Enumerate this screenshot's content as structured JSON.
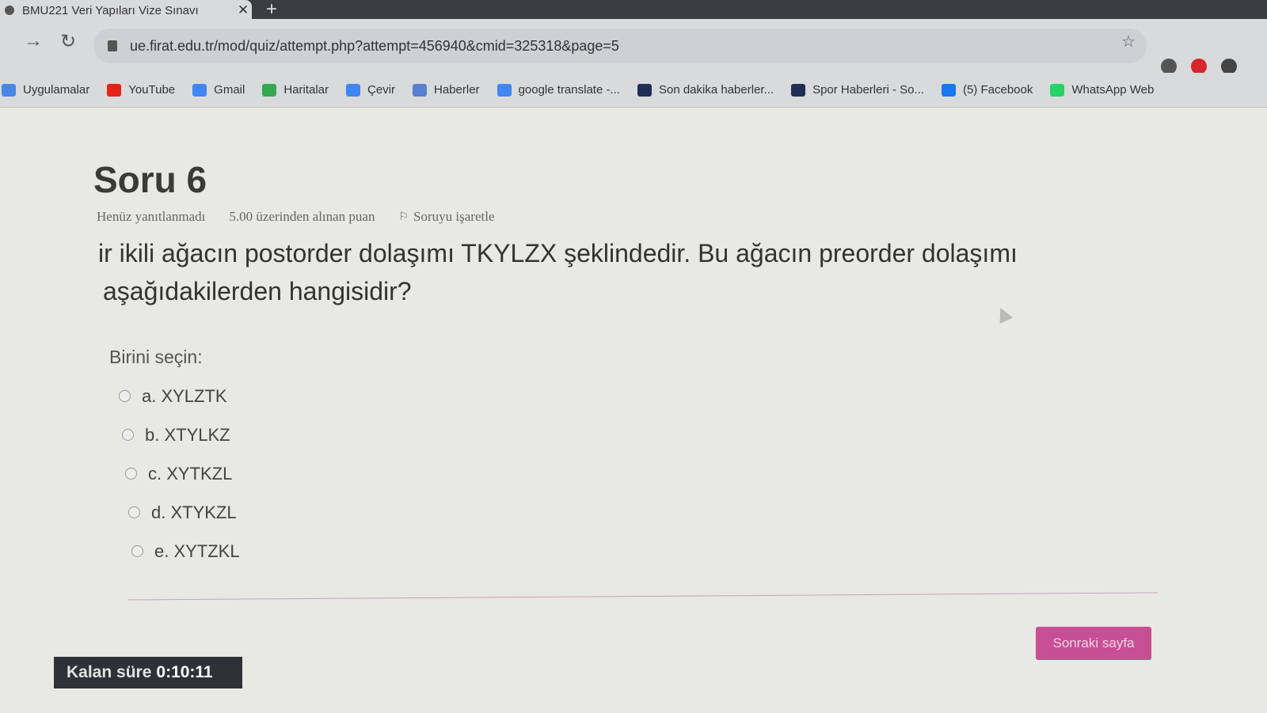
{
  "browser": {
    "tab_title": "BMU221 Veri Yapıları Vize Sınavı",
    "tab_close": "✕",
    "new_tab": "+",
    "url": "ue.firat.edu.tr/mod/quiz/attempt.php?attempt=456940&cmid=325318&page=5",
    "bookmarks": [
      {
        "label": "Uygulamalar",
        "icon": "apps-grid-icon",
        "color": "#4a86e8"
      },
      {
        "label": "YouTube",
        "icon": "youtube-icon",
        "color": "#e62117"
      },
      {
        "label": "Gmail",
        "icon": "google-icon",
        "color": "#4285f4"
      },
      {
        "label": "Haritalar",
        "icon": "maps-icon",
        "color": "#34a853"
      },
      {
        "label": "Çevir",
        "icon": "translate-icon",
        "color": "#4285f4"
      },
      {
        "label": "Haberler",
        "icon": "news-icon",
        "color": "#5b7fd1"
      },
      {
        "label": "google translate -...",
        "icon": "google-icon",
        "color": "#4285f4"
      },
      {
        "label": "Son dakika haberler...",
        "icon": "news-site-icon",
        "color": "#1f2f55"
      },
      {
        "label": "Spor Haberleri - So...",
        "icon": "news-site-icon",
        "color": "#1f2f55"
      },
      {
        "label": "(5) Facebook",
        "icon": "facebook-icon",
        "color": "#1877f2"
      },
      {
        "label": "WhatsApp Web",
        "icon": "whatsapp-icon",
        "color": "#25d366"
      }
    ]
  },
  "question": {
    "title": "Soru 6",
    "status": "Henüz yanıtlanmadı",
    "points": "5.00 üzerinden alınan puan",
    "flag_label": "Soruyu işaretle",
    "text_line1": "ir ikili ağacın postorder dolaşımı TKYLZX şeklindedir. Bu ağacın preorder dolaşımı",
    "text_line2": "aşağıdakilerden hangisidir?",
    "prompt": "Birini seçin:",
    "options": [
      "a. XYLZTK",
      "b. XTYLKZ",
      "c. XYTKZL",
      "d. XTYKZL",
      "e. XYTZKL"
    ]
  },
  "navigation": {
    "next_label": "Sonraki sayfa"
  },
  "timer": {
    "label": "Kalan süre",
    "value": "0:10:11"
  },
  "colors": {
    "accent": "#c74f93",
    "timer_bg": "#2e3236"
  }
}
